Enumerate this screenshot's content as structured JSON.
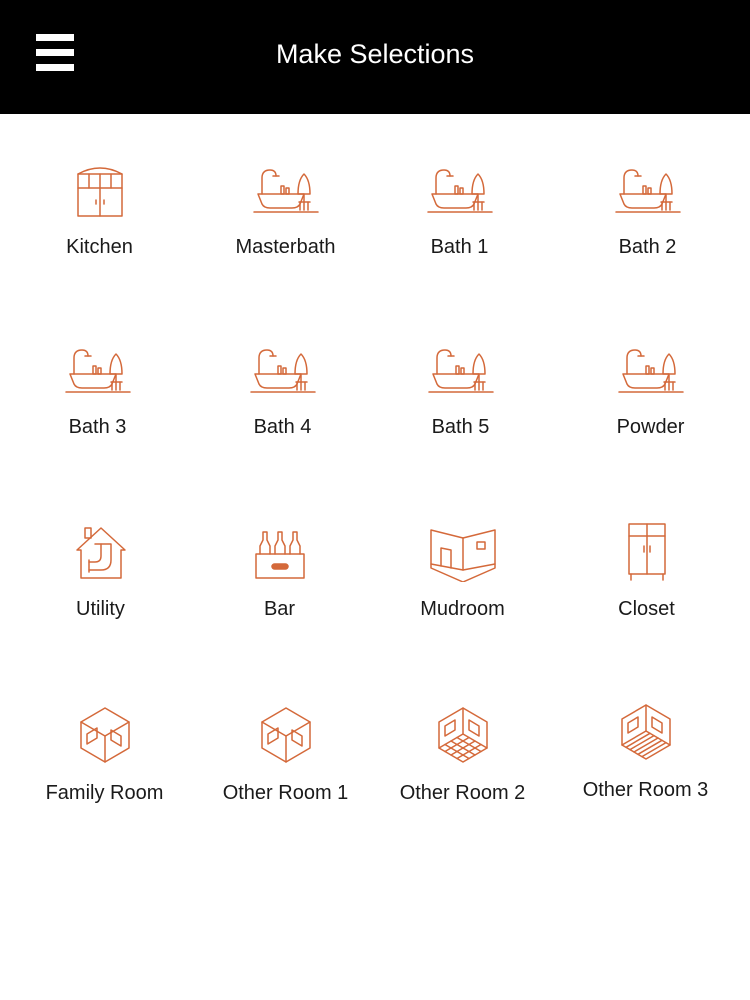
{
  "header": {
    "title": "Make Selections",
    "menu_icon": "hamburger-menu-icon",
    "background": "#000000",
    "text_color": "#ffffff"
  },
  "accent_color": "#d4693a",
  "rooms": [
    {
      "label": "Kitchen",
      "icon": "kitchen-cabinet-icon"
    },
    {
      "label": "Masterbath",
      "icon": "bathtub-icon"
    },
    {
      "label": "Bath 1",
      "icon": "bathtub-icon"
    },
    {
      "label": "Bath 2",
      "icon": "bathtub-icon"
    },
    {
      "label": "Bath 3",
      "icon": "bathtub-icon"
    },
    {
      "label": "Bath 4",
      "icon": "bathtub-icon"
    },
    {
      "label": "Bath 5",
      "icon": "bathtub-icon"
    },
    {
      "label": "Powder",
      "icon": "bathtub-icon"
    },
    {
      "label": "Utility",
      "icon": "house-pipe-icon"
    },
    {
      "label": "Bar",
      "icon": "bottles-crate-icon"
    },
    {
      "label": "Mudroom",
      "icon": "room-corner-icon"
    },
    {
      "label": "Closet",
      "icon": "wardrobe-icon"
    },
    {
      "label": "Family Room",
      "icon": "isometric-room-icon"
    },
    {
      "label": "Other Room 1",
      "icon": "isometric-room-icon"
    },
    {
      "label": "Other Room 2",
      "icon": "isometric-room-tiled-icon"
    },
    {
      "label": "Other Room 3",
      "icon": "isometric-room-striped-icon"
    }
  ]
}
